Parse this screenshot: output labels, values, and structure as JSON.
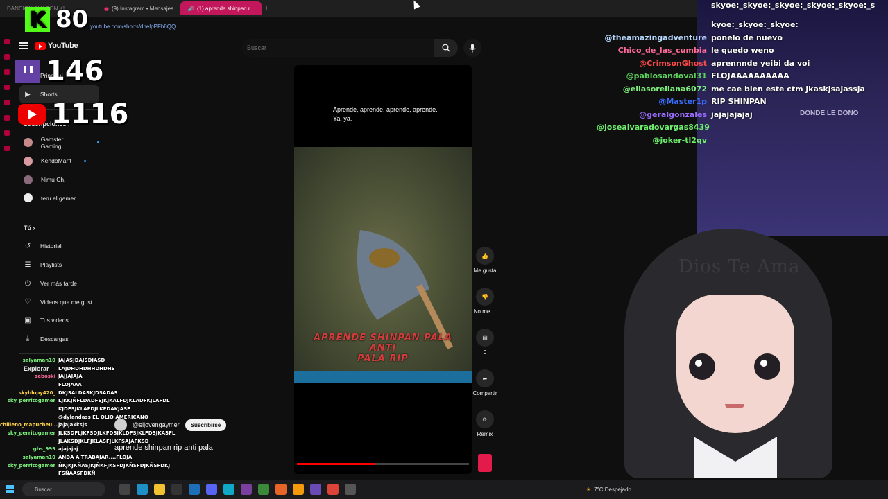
{
  "browser": {
    "tabs": [
      {
        "label": "(9) Instagram • Mensajes",
        "active": false
      },
      {
        "label": "(1) aprende shinpan r...",
        "active": true
      }
    ],
    "tab_partial": "DANCION SHARON KI",
    "url": "youtube.com/shorts/dhelpPFb8QQ"
  },
  "overlay": {
    "kick_count": "80",
    "twitch_count": "146",
    "youtube_count": "1116"
  },
  "youtube": {
    "logo_text": "YouTube",
    "search_placeholder": "Buscar",
    "sidebar": {
      "main": [
        {
          "label": "Principal",
          "icon": "home-icon",
          "active": false
        },
        {
          "label": "Shorts",
          "icon": "shorts-icon",
          "active": true
        }
      ],
      "subs_heading": "Suscripciones",
      "subscriptions": [
        {
          "label": "Gamster Gaming",
          "dot": true
        },
        {
          "label": "KendoMarft",
          "dot": true
        },
        {
          "label": "Nimu Ch.",
          "dot": false
        },
        {
          "label": "teru el gamer",
          "dot": false
        }
      ],
      "you_heading": "Tú",
      "you_items": [
        {
          "label": "Historial",
          "icon": "history-icon"
        },
        {
          "label": "Playlists",
          "icon": "playlist-icon"
        },
        {
          "label": "Ver más tarde",
          "icon": "clock-icon"
        },
        {
          "label": "Videos que me gust...",
          "icon": "like-icon"
        },
        {
          "label": "Tus videos",
          "icon": "video-icon"
        },
        {
          "label": "Descargas",
          "icon": "download-icon"
        }
      ],
      "explore_heading": "Explorar"
    },
    "short": {
      "caption": "Aprende, aprende, aprende, aprende. Ya, ya.",
      "overlay_line1": "APRENDE SHINPAN PALA ANTI",
      "overlay_line2": "PALA RIP",
      "channel": "@eljovengaymer",
      "subscribe": "Suscribirse",
      "title": "aprende shinpan rip anti pala",
      "progress": 0.45
    },
    "actions": [
      {
        "icon": "thumbs-up-icon",
        "label": "Me gusta"
      },
      {
        "icon": "thumbs-down-icon",
        "label": "No me ..."
      },
      {
        "icon": "comment-icon",
        "label": "0"
      },
      {
        "icon": "share-icon",
        "label": "Compartir"
      },
      {
        "icon": "remix-icon",
        "label": "Remix"
      }
    ]
  },
  "chat_right": [
    {
      "user": "",
      "msg": "skyoe:_skyoe:_skyoe:_skyoe:_skyoe:_s",
      "color": "#ffffff"
    },
    {
      "user": "",
      "msg": "kyoe:_skyoe:_skyoe:",
      "color": "#ffffff"
    },
    {
      "user": "@theamazingadventure",
      "msg": "ponelo de nuevo",
      "color": "#b7d8ff"
    },
    {
      "user": "Chico_de_las_cumbia",
      "msg": "le quedo weno",
      "color": "#ff6b9a"
    },
    {
      "user": "@CrimsonGhost",
      "msg": "aprennnde yeibi da voi",
      "color": "#ff4a4a"
    },
    {
      "user": "@pablosandoval31",
      "msg": "FLOJAAAAAAAAAA",
      "color": "#5cd35c"
    },
    {
      "user": "@eliasorellana6072",
      "msg": "me cae bien este ctm jkaskjsajassja",
      "color": "#7cf07c"
    },
    {
      "user": "@Master1p",
      "msg": "RIP SHINPAN",
      "color": "#3b6dff"
    },
    {
      "user": "@geralgonzales",
      "msg": "jajajajajaj",
      "color": "#9b6dff"
    },
    {
      "user": "@josealvaradovargas8439",
      "msg": "",
      "color": "#6ef06e"
    },
    {
      "user": "@joker-tl2qv",
      "msg": "",
      "color": "#6ef06e"
    }
  ],
  "donde_label": "DONDE LE DONO",
  "vtuber_text": "Dios Te Ama",
  "chat_left": [
    {
      "user": "salyaman10",
      "msg": "JAJASJDAJSDJASD",
      "color": "#7cf07c"
    },
    {
      "user": "",
      "msg": "LAJDHDHDHHDHDHS",
      "color": "#ffffff"
    },
    {
      "user": "seboski",
      "msg": "JAJJAJAJA",
      "color": "#ff6b9a"
    },
    {
      "user": "",
      "msg": "FLOJAAA",
      "color": "#ffffff"
    },
    {
      "user": "skyblopy420_",
      "msg": "DKJSALDASKJDSADAS",
      "color": "#ffd24a"
    },
    {
      "user": "sky_perritogamer",
      "msg": "LJKKJÑFLDADFSJKJKALFDJKLADFKJLAFDL",
      "color": "#7cf07c"
    },
    {
      "user": "",
      "msg": "KJDFSJKLAFDJLKFDAKJASF",
      "color": "#ffffff"
    },
    {
      "user": "",
      "msg": "@dylandass EL QLIO AMERICANO",
      "color": "#ffffff"
    },
    {
      "user": "chilleno_mapuche0...",
      "msg": "jajajakksjs",
      "color": "#ffd24a"
    },
    {
      "user": "sky_perritogamer",
      "msg": "JLKSDFLJKFSDJLKFDSJKLDFSJKLFDSJKASFL",
      "color": "#7cf07c"
    },
    {
      "user": "",
      "msg": "JLAKSDJKLFJKLASFJLKFSAJAFKSD",
      "color": "#ffffff"
    },
    {
      "user": "ghs_999",
      "msg": "ajajajaj",
      "color": "#7cf07c"
    },
    {
      "user": "salyaman10",
      "msg": "ANDA A TRABAJAR....FLOJA",
      "color": "#7cf07c"
    },
    {
      "user": "sky_perritogamer",
      "msg": "ÑKJKJKÑASJKJÑKFJKSFDJKÑSFDJKÑSFDKJ",
      "color": "#7cf07c"
    },
    {
      "user": "",
      "msg": "FSÑAASFDKÑ",
      "color": "#ffffff"
    }
  ],
  "taskbar": {
    "search": "Buscar",
    "weather": "7°C  Despejado"
  }
}
